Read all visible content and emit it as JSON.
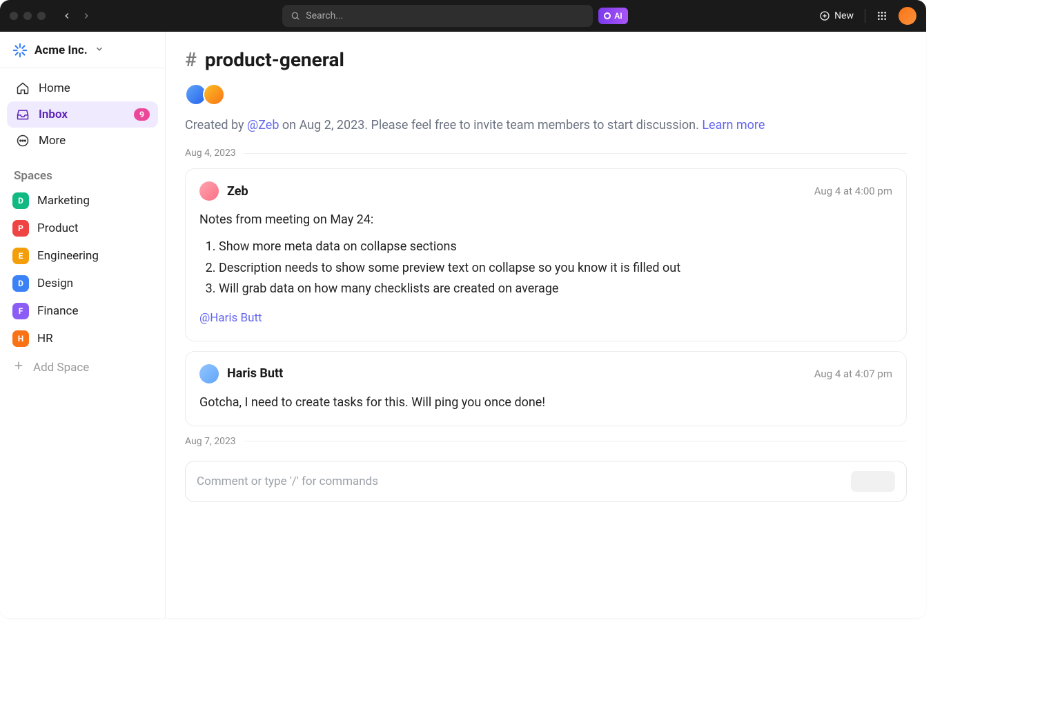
{
  "topbar": {
    "search_placeholder": "Search...",
    "ai_label": "AI",
    "new_label": "New"
  },
  "sidebar": {
    "workspace_name": "Acme Inc.",
    "nav": {
      "home": "Home",
      "inbox": "Inbox",
      "inbox_badge": "9",
      "more": "More"
    },
    "spaces_title": "Spaces",
    "spaces": [
      {
        "initial": "D",
        "label": "Marketing",
        "color": "#10b981"
      },
      {
        "initial": "P",
        "label": "Product",
        "color": "#ef4444"
      },
      {
        "initial": "E",
        "label": "Engineering",
        "color": "#f59e0b"
      },
      {
        "initial": "D",
        "label": "Design",
        "color": "#3b82f6"
      },
      {
        "initial": "F",
        "label": "Finance",
        "color": "#8b5cf6"
      },
      {
        "initial": "H",
        "label": "HR",
        "color": "#f97316"
      }
    ],
    "add_space": "Add Space"
  },
  "channel": {
    "name": "product-general",
    "desc_prefix": "Created by ",
    "desc_mention": "@Zeb",
    "desc_mid": " on Aug 2, 2023. Please feel free to invite team members to start discussion. ",
    "learn_more": "Learn more",
    "date_sep_1": "Aug 4, 2023",
    "date_sep_2": "Aug 7, 2023"
  },
  "messages": [
    {
      "author": "Zeb",
      "time": "Aug 4 at 4:00 pm",
      "body_intro": "Notes from meeting on May 24:",
      "list": [
        "Show more meta data on collapse sections",
        "Description needs to show some preview text on collapse so you know it is filled out",
        "Will grab data on how many checklists are created on average"
      ],
      "mention": "@Haris Butt"
    },
    {
      "author": "Haris Butt",
      "time": "Aug 4 at 4:07 pm",
      "body": "Gotcha, I need to create tasks for this. Will ping you once done!"
    }
  ],
  "composer": {
    "placeholder": "Comment or type '/' for commands"
  }
}
